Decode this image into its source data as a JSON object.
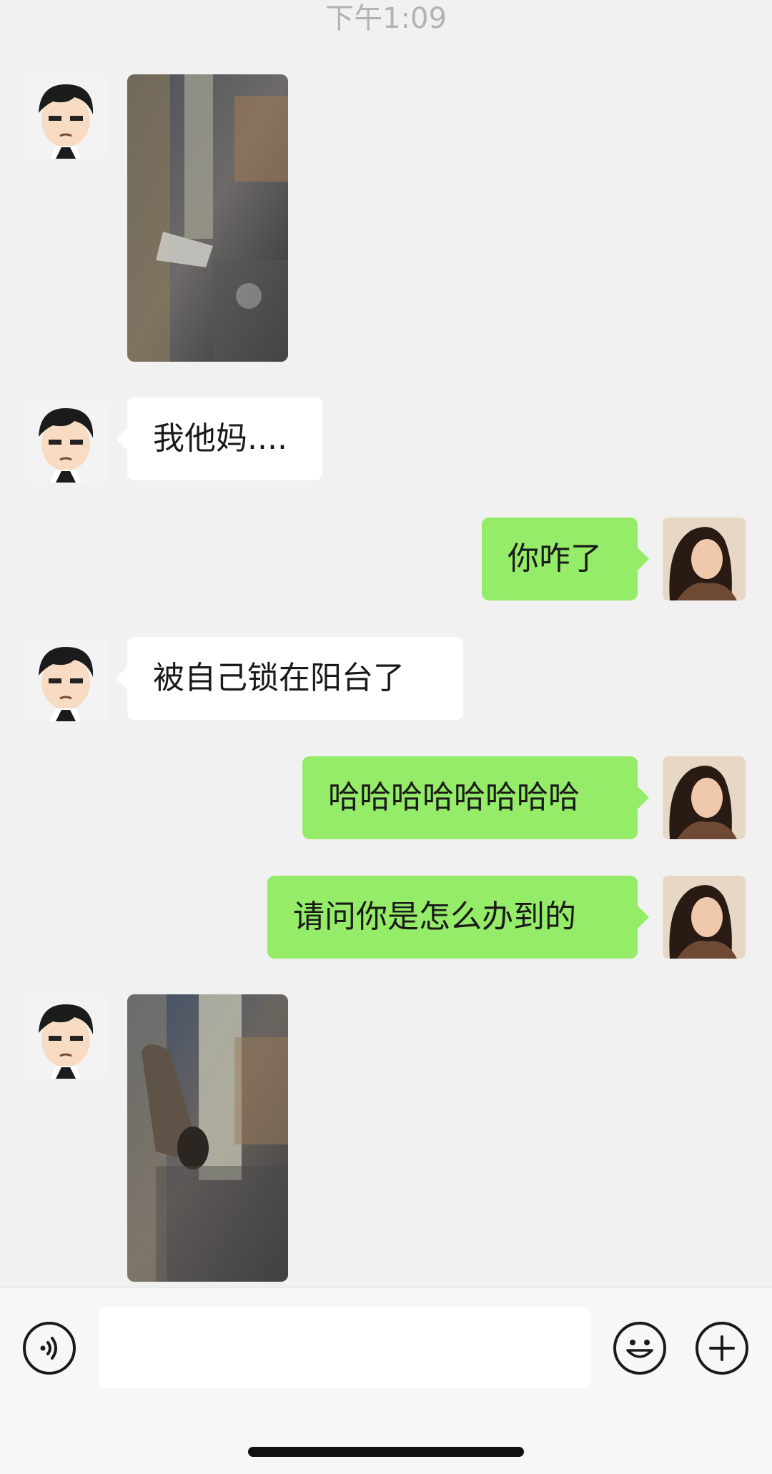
{
  "status": {
    "time": "下午1:09"
  },
  "messages": [
    {
      "sender": "friend",
      "type": "image",
      "description": "window latch photo"
    },
    {
      "sender": "friend",
      "type": "text",
      "text": "我他妈...."
    },
    {
      "sender": "me",
      "type": "text",
      "text": "你咋了"
    },
    {
      "sender": "friend",
      "type": "text",
      "text": "被自己锁在阳台了"
    },
    {
      "sender": "me",
      "type": "text",
      "text": "哈哈哈哈哈哈哈哈"
    },
    {
      "sender": "me",
      "type": "text",
      "text": "请问你是怎么办到的"
    },
    {
      "sender": "friend",
      "type": "image",
      "description": "window lock close-up photo"
    }
  ],
  "input": {
    "value": "",
    "placeholder": ""
  },
  "colors": {
    "background": "#f1f1f1",
    "incoming_bubble": "#ffffff",
    "outgoing_bubble": "#95ec69",
    "text": "#1a1a1a",
    "timestamp": "#b3b3b3"
  },
  "icons": [
    "voice-icon",
    "emoji-icon",
    "plus-icon"
  ]
}
